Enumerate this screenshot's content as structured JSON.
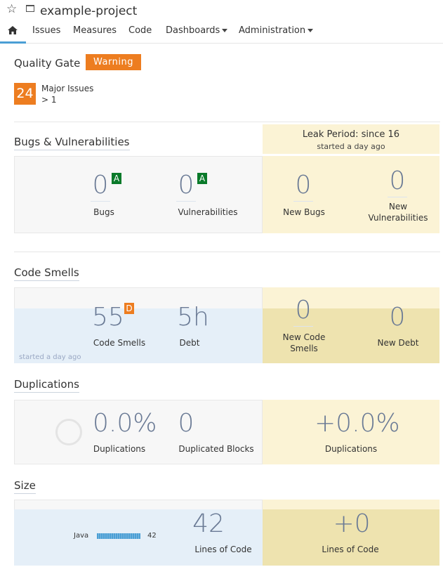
{
  "header": {
    "project_name": "example-project",
    "star_icon": "star-icon",
    "folder_icon": "project-icon"
  },
  "nav": {
    "home_icon": "home-icon",
    "items": [
      {
        "label": "Issues"
      },
      {
        "label": "Measures"
      },
      {
        "label": "Code"
      },
      {
        "label": "Dashboards"
      },
      {
        "label": "Administration"
      }
    ]
  },
  "quality_gate": {
    "title": "Quality Gate",
    "status": "Warning",
    "status_color": "#ed7d20",
    "condition_value": "24",
    "condition_metric": "Major Issues",
    "condition_threshold": "> 1"
  },
  "bugs_vulns": {
    "title": "Bugs & Vulnerabilities",
    "leak_period": "Leak Period: since 16",
    "leak_started": "started a day ago",
    "bugs_value": "0",
    "bugs_rating": "A",
    "bugs_label": "Bugs",
    "vulns_value": "0",
    "vulns_rating": "A",
    "vulns_label": "Vulnerabilities",
    "new_bugs_value": "0",
    "new_bugs_label": "New Bugs",
    "new_vulns_value": "0",
    "new_vulns_label_1": "New",
    "new_vulns_label_2": "Vulnerabilities"
  },
  "code_smells": {
    "title": "Code Smells",
    "smells_value": "55",
    "smells_rating": "D",
    "smells_label": "Code Smells",
    "debt_value": "5h",
    "debt_label": "Debt",
    "started": "started a day ago",
    "new_smells_value": "0",
    "new_smells_label_1": "New Code",
    "new_smells_label_2": "Smells",
    "new_debt_value": "0",
    "new_debt_label": "New Debt"
  },
  "duplications": {
    "title": "Duplications",
    "dup_value": "0.0%",
    "dup_label": "Duplications",
    "blocks_value": "0",
    "blocks_label": "Duplicated Blocks",
    "new_dup_value": "+0.0%",
    "new_dup_label": "Duplications"
  },
  "size": {
    "title": "Size",
    "language": "Java",
    "language_loc": "42",
    "loc_value": "42",
    "loc_label": "Lines of Code",
    "new_loc_value": "+0",
    "new_loc_label": "Lines of Code"
  },
  "colors": {
    "accent": "#4b9fd5",
    "rating_a": "#0a7a2a",
    "rating_d": "#ed7d20",
    "leak_bg": "#fbf3d5"
  }
}
